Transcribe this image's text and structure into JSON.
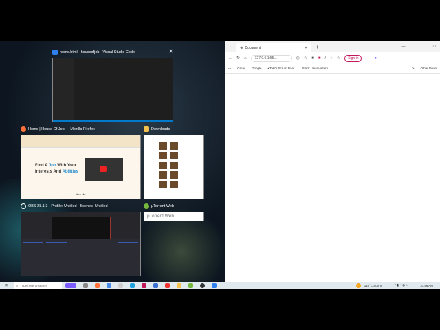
{
  "snap_assist": {
    "windows": [
      {
        "title": "home.html - houseofjob - Visual Studio Code",
        "icon": "vscode-icon",
        "accent": "#2f80ed"
      },
      {
        "title": "Home | House Of Job — Mozilla Firefox",
        "icon": "firefox-icon",
        "accent": "#ff7139",
        "preview": {
          "headline_a": "Find A ",
          "headline_job": "Job",
          "headline_b": " With Your",
          "headline_c": "Interests And ",
          "headline_abilities": "Abilities",
          "footer": "Hire Me"
        }
      },
      {
        "title": "Downloads",
        "icon": "folder-icon",
        "accent": "#f2c14e"
      },
      {
        "title": "OBS 28.1.3 - Profile: Untitled - Scenes: Untitled",
        "icon": "obs-icon",
        "accent": "#ffffff"
      },
      {
        "title": "µTorrent Web",
        "icon": "utorrent-icon",
        "accent": "#76b83f",
        "preview_text": "µTorrent Web"
      }
    ],
    "close_label": "✕"
  },
  "browser": {
    "tab_title": "Document",
    "tab_close": "✕",
    "new_tab": "+",
    "url": "127.0.0.1:55...",
    "sign_in": "Sign in",
    "more": "···",
    "bookmarks": [
      "Gmail",
      "Google",
      "• Taki's Scrum Boa...",
      "Slack | team-intern..."
    ],
    "bookmarks_more": ">",
    "other_favorites": "Other favori"
  },
  "taskbar": {
    "search_placeholder": "Type here to search",
    "weather": "115°C  Sunny",
    "time": "10:46 AM"
  }
}
